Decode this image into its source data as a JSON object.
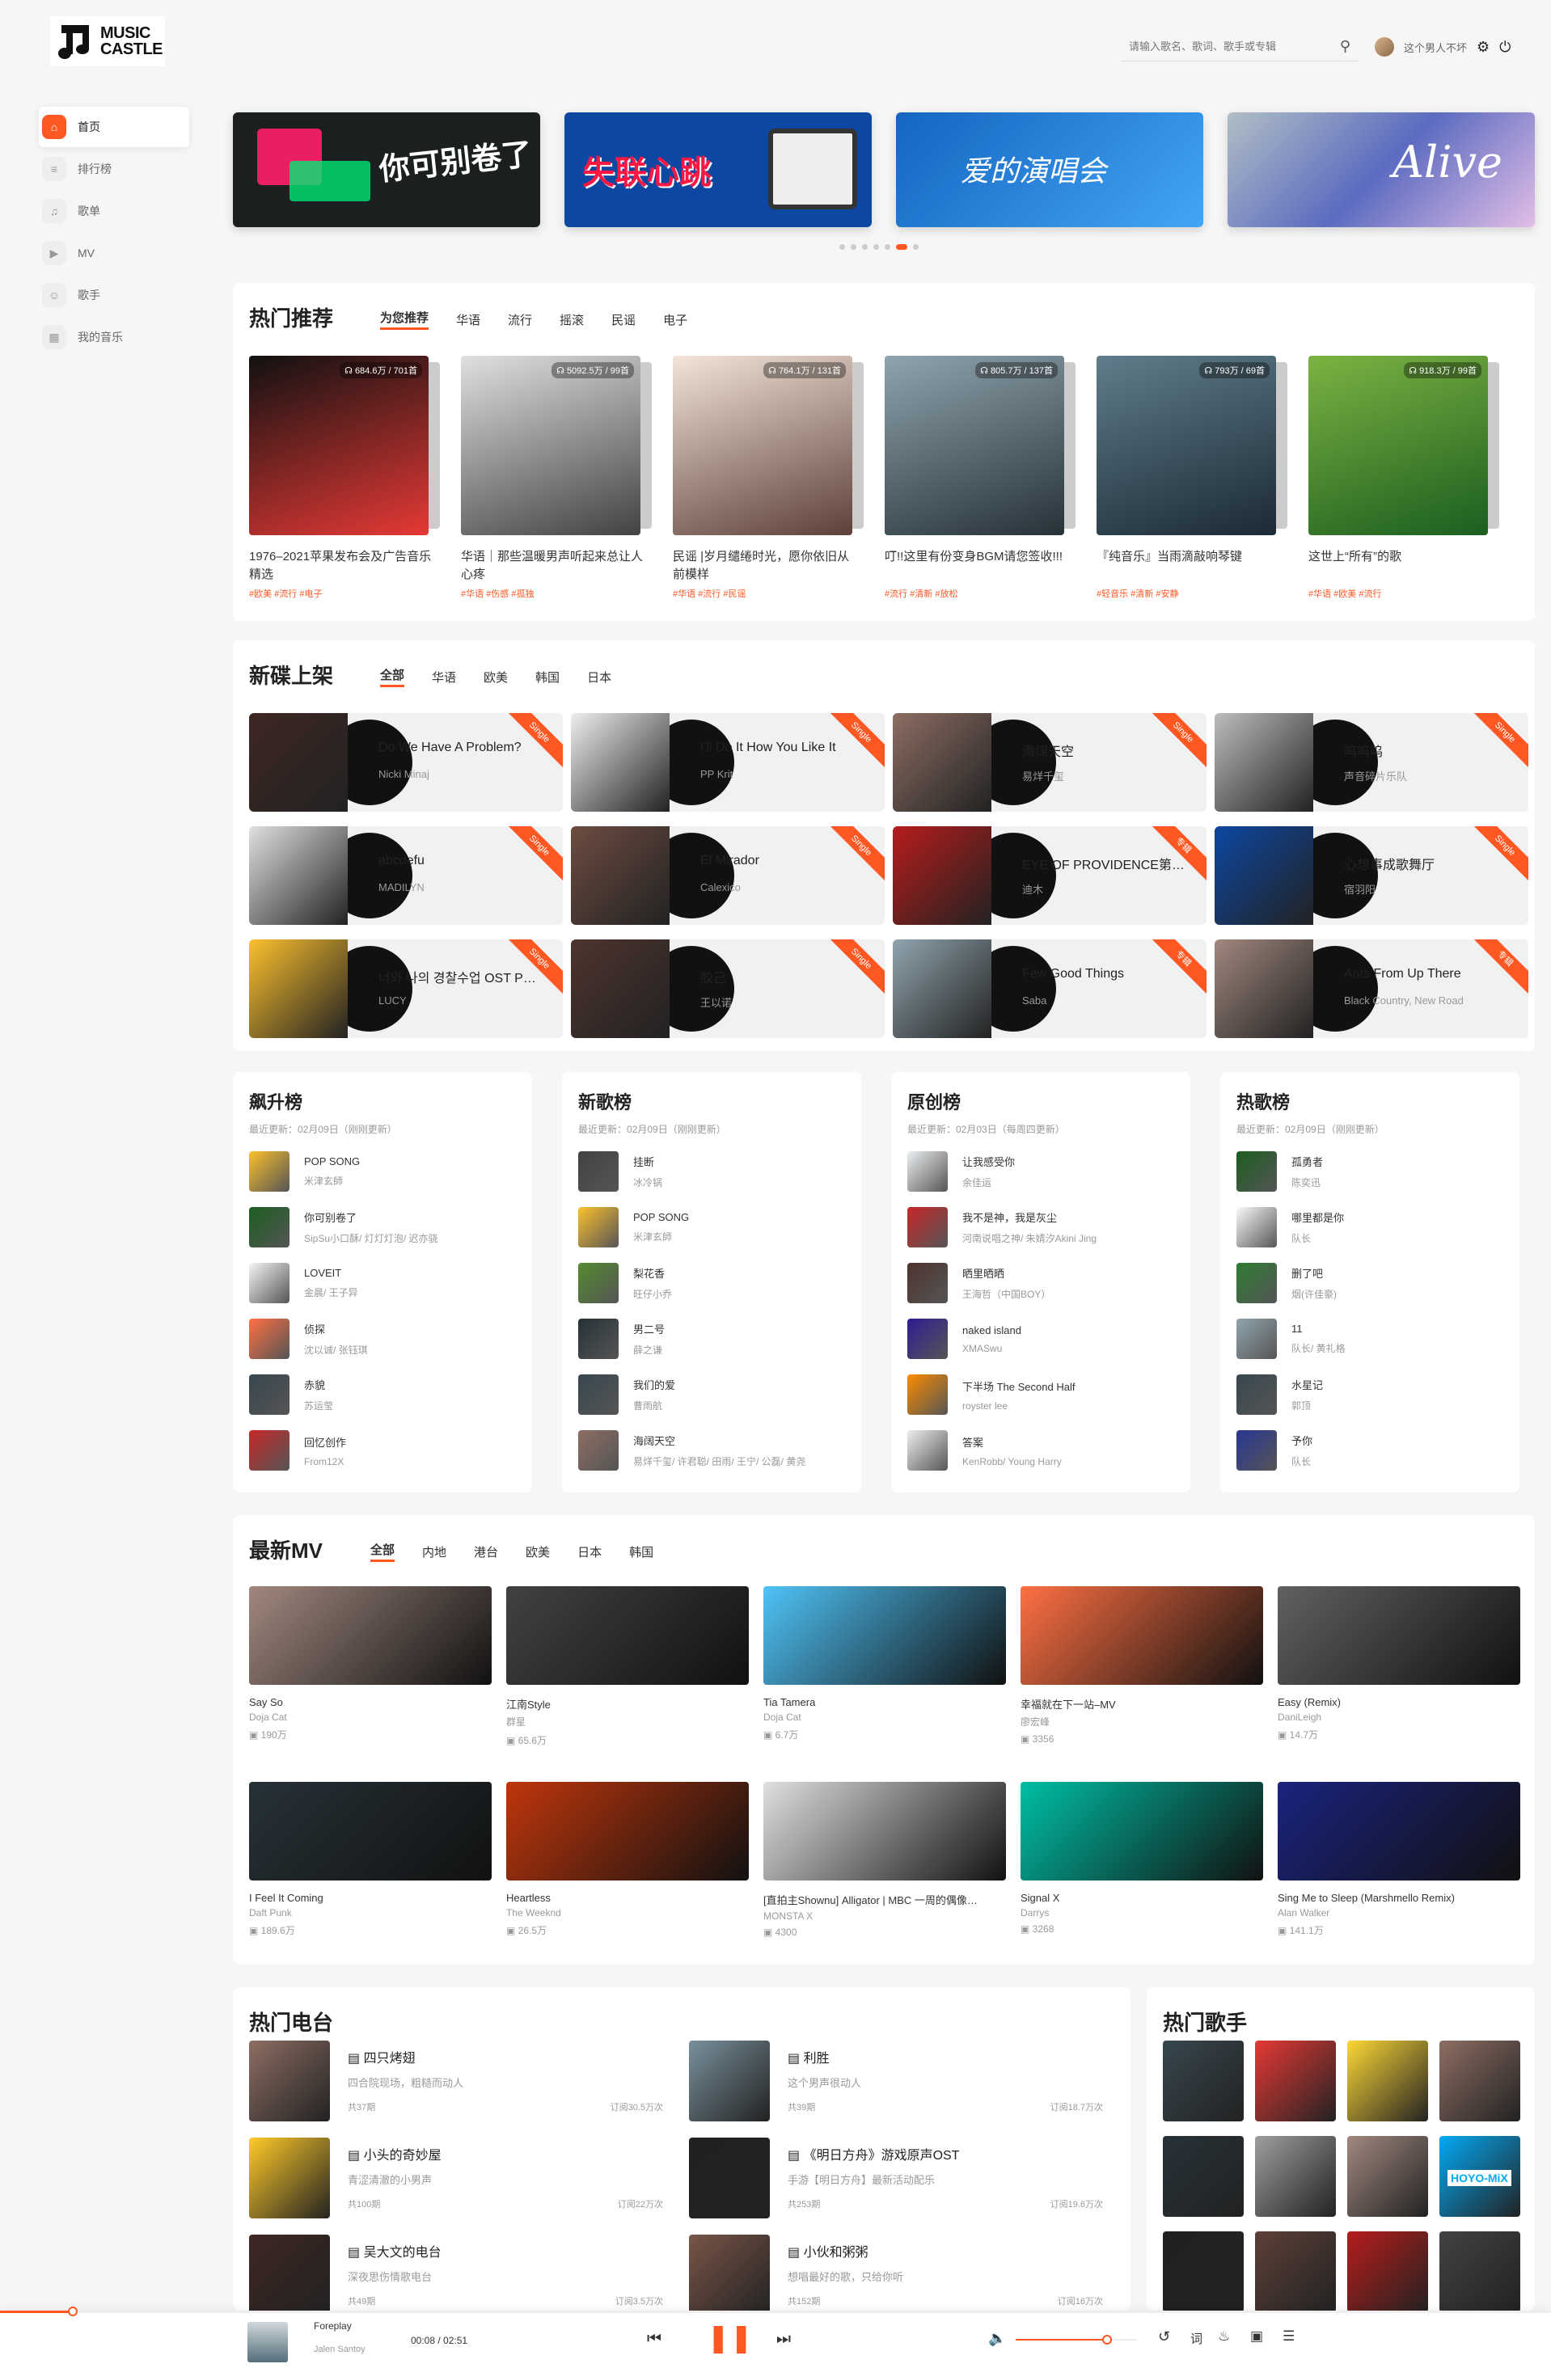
{
  "brand": {
    "line1": "MUSIC",
    "line2": "CASTLE"
  },
  "search": {
    "placeholder": "请输入歌名、歌词、歌手或专辑"
  },
  "user": {
    "name": "这个男人不坏"
  },
  "sidebar": {
    "items": [
      {
        "label": "首页",
        "icon": "home-icon"
      },
      {
        "label": "排行榜",
        "icon": "chart-icon"
      },
      {
        "label": "歌单",
        "icon": "playlist-icon"
      },
      {
        "label": "MV",
        "icon": "video-icon"
      },
      {
        "label": "歌手",
        "icon": "singer-icon"
      },
      {
        "label": "我的音乐",
        "icon": "grid-icon"
      }
    ]
  },
  "banners": [
    {
      "text": "你可别卷了",
      "bg": "#1b1f1f"
    },
    {
      "text": "失联心跳",
      "bg": "#0d47a1"
    },
    {
      "text": "爱的演唱会",
      "bg": "#1e88e5"
    },
    {
      "text": "Alive",
      "bg": "#6a8fc7"
    }
  ],
  "hot": {
    "title": "热门推荐",
    "tabs": [
      "为您推荐",
      "华语",
      "流行",
      "摇滚",
      "民谣",
      "电子"
    ],
    "items": [
      {
        "plays": "684.6万 / 701首",
        "title": "1976–2021苹果发布会及广告音乐精选",
        "tags": "#欧美 #流行 #电子",
        "c1": "#111",
        "c2": "#e53935"
      },
      {
        "plays": "5092.5万 / 99首",
        "title": "华语｜那些温暖男声听起来总让人心疼",
        "tags": "#华语 #伤感 #孤独",
        "c1": "#e0e0e0",
        "c2": "#424242"
      },
      {
        "plays": "764.1万 / 131首",
        "title": "民谣 |岁月缱绻时光，愿你依旧从前模样",
        "tags": "#华语 #流行 #民谣",
        "c1": "#f3e5d8",
        "c2": "#5d4037"
      },
      {
        "plays": "805.7万 / 137首",
        "title": "叮!!这里有份变身BGM请您签收!!!",
        "tags": "#流行 #清新 #放松",
        "c1": "#90a4ae",
        "c2": "#263238"
      },
      {
        "plays": "793万 / 69首",
        "title": "『纯音乐』当雨滴敲响琴键",
        "tags": "#轻音乐 #清新 #安静",
        "c1": "#607d8b",
        "c2": "#1b2a34"
      },
      {
        "plays": "918.3万 / 99首",
        "title": "这世上“所有”的歌",
        "tags": "#华语 #欧美 #流行",
        "c1": "#7cb342",
        "c2": "#1b5e20"
      }
    ]
  },
  "albums": {
    "title": "新碟上架",
    "tabs": [
      "全部",
      "华语",
      "欧美",
      "韩国",
      "日本"
    ],
    "items": [
      {
        "title": "Do We Have A Problem?",
        "artist": "Nicki Minaj",
        "tag": "Single",
        "c": "#3e2723"
      },
      {
        "title": "I'll Do It How You Like It",
        "artist": "PP Krit",
        "tag": "Single",
        "c": "#eeeeee"
      },
      {
        "title": "海阔天空",
        "artist": "易烊千玺",
        "tag": "Single",
        "c": "#8d6e63"
      },
      {
        "title": "呜呜呜",
        "artist": "声音碎片乐队",
        "tag": "Single",
        "c": "#bdbdbd"
      },
      {
        "title": "abcdefu",
        "artist": "MADILYN",
        "tag": "Single",
        "c": "#e0e0e0"
      },
      {
        "title": "El Mirador",
        "artist": "Calexico",
        "tag": "Single",
        "c": "#6d4c41"
      },
      {
        "title": "EYE OF PROVIDENCE第…",
        "artist": "迪木",
        "tag": "专辑",
        "c": "#b71c1c"
      },
      {
        "title": "心想事成歌舞厅",
        "artist": "宿羽阳",
        "tag": "Single",
        "c": "#0d47a1"
      },
      {
        "title": "너와 나의 경찰수업 OST P…",
        "artist": "LUCY",
        "tag": "Single",
        "c": "#fbc02d"
      },
      {
        "title": "胶己",
        "artist": "王以诺",
        "tag": "Single",
        "c": "#4e342e"
      },
      {
        "title": "Few Good Things",
        "artist": "Saba",
        "tag": "专辑",
        "c": "#90a4ae"
      },
      {
        "title": "Ants From Up There",
        "artist": "Black Country, New Road",
        "tag": "专辑",
        "c": "#a1887f"
      }
    ]
  },
  "charts": [
    {
      "title": "飙升榜",
      "update": "最近更新：02月09日（刚刚更新）",
      "songs": [
        {
          "s": "POP SONG",
          "a": "米津玄師",
          "c": "#fbc02d"
        },
        {
          "s": "你可别卷了",
          "a": "SipSu小口酥/ 灯灯灯泡/ 迟亦骁",
          "c": "#1b5e20"
        },
        {
          "s": "LOVEIT",
          "a": "金晨/ 王子异",
          "c": "#f5f5f5"
        },
        {
          "s": "侦探",
          "a": "沈以诚/ 张钰琪",
          "c": "#ff7043"
        },
        {
          "s": "赤貌",
          "a": "苏运莹",
          "c": "#37474f"
        },
        {
          "s": "回忆创作",
          "a": "From12X",
          "c": "#c62828"
        }
      ]
    },
    {
      "title": "新歌榜",
      "update": "最近更新：02月09日（刚刚更新）",
      "songs": [
        {
          "s": "挂断",
          "a": "冰冷锅",
          "c": "#424242"
        },
        {
          "s": "POP SONG",
          "a": "米津玄師",
          "c": "#fbc02d"
        },
        {
          "s": "梨花香",
          "a": "旺仔小乔",
          "c": "#558b2f"
        },
        {
          "s": "男二号",
          "a": "薛之谦",
          "c": "#263238"
        },
        {
          "s": "我们的爱",
          "a": "曹雨航",
          "c": "#37474f"
        },
        {
          "s": "海阔天空",
          "a": "易烊千玺/ 许君聪/ 田雨/ 王宁/ 公磊/ 黄尧",
          "c": "#8d6e63"
        }
      ]
    },
    {
      "title": "原创榜",
      "update": "最近更新：02月03日（每周四更新）",
      "songs": [
        {
          "s": "让我感受你",
          "a": "余佳运",
          "c": "#eceff1"
        },
        {
          "s": "我不是神，我是灰尘",
          "a": "河南说唱之神/ 朱婧汐Akini Jing",
          "c": "#c62828"
        },
        {
          "s": "晒里晒晒",
          "a": "王海哲（中国BOY）",
          "c": "#4e342e"
        },
        {
          "s": "naked island",
          "a": "XMASwu",
          "c": "#311b92"
        },
        {
          "s": "下半场 The Second Half",
          "a": "royster lee",
          "c": "#fb8c00"
        },
        {
          "s": "答案",
          "a": "KenRobb/ Young Harry",
          "c": "#eeeeee"
        }
      ]
    },
    {
      "title": "热歌榜",
      "update": "最近更新：02月09日（刚刚更新）",
      "songs": [
        {
          "s": "孤勇者",
          "a": "陈奕迅",
          "c": "#1b5e20"
        },
        {
          "s": "哪里都是你",
          "a": "队长",
          "c": "#fafafa"
        },
        {
          "s": "删了吧",
          "a": "烟(许佳豪)",
          "c": "#2e7d32"
        },
        {
          "s": "11",
          "a": "队长/ 黄礼格",
          "c": "#90a4ae"
        },
        {
          "s": "水星记",
          "a": "郭顶",
          "c": "#37474f"
        },
        {
          "s": "予你",
          "a": "队长",
          "c": "#283593"
        }
      ]
    }
  ],
  "mv": {
    "title": "最新MV",
    "tabs": [
      "全部",
      "内地",
      "港台",
      "欧美",
      "日本",
      "韩国"
    ],
    "items": [
      {
        "t": "Say So",
        "a": "Doja Cat",
        "p": "190万",
        "c": "#a1887f"
      },
      {
        "t": "江南Style",
        "a": "群星",
        "p": "65.6万",
        "c": "#424242"
      },
      {
        "t": "Tia Tamera",
        "a": "Doja Cat",
        "p": "6.7万",
        "c": "#4fc3f7"
      },
      {
        "t": "幸福就在下一站–MV",
        "a": "廖宏峰",
        "p": "3356",
        "c": "#ff7043"
      },
      {
        "t": "Easy (Remix)",
        "a": "DaniLeigh",
        "p": "14.7万",
        "c": "#616161"
      },
      {
        "t": "I Feel It Coming",
        "a": "Daft Punk",
        "p": "189.6万",
        "c": "#263238"
      },
      {
        "t": "Heartless",
        "a": "The Weeknd",
        "p": "26.5万",
        "c": "#bf360c"
      },
      {
        "t": "[直拍主Shownu] Alligator | MBC 一周的偶像…",
        "a": "MONSTA X",
        "p": "4300",
        "c": "#e0e0e0"
      },
      {
        "t": "Signal X",
        "a": "Darrys",
        "p": "3268",
        "c": "#00bfa5"
      },
      {
        "t": "Sing Me to Sleep (Marshmello Remix)",
        "a": "Alan Walker",
        "p": "141.1万",
        "c": "#1a237e"
      }
    ]
  },
  "radio": {
    "title": "热门电台",
    "items": [
      {
        "n": "四只烤翅",
        "d": "四合院现场，粗糙而动人",
        "p": "共37期",
        "s": "订阅30.5万次",
        "c": "#8d6e63"
      },
      {
        "n": "利胜",
        "d": "这个男声很动人",
        "p": "共39期",
        "s": "订阅18.7万次",
        "c": "#78909c"
      },
      {
        "n": "小头的奇妙屋",
        "d": "青涩清澈的小男声",
        "p": "共100期",
        "s": "订阅22万次",
        "c": "#ffca28"
      },
      {
        "n": "《明日方舟》游戏原声OST",
        "d": "手游【明日方舟】最新活动配乐",
        "p": "共253期",
        "s": "订阅19.6万次",
        "c": "#212121"
      },
      {
        "n": "吴大文的电台",
        "d": "深夜思伤情歌电台",
        "p": "共49期",
        "s": "订阅3.5万次",
        "c": "#3e2723"
      },
      {
        "n": "小伙和粥粥",
        "d": "想唱最好的歌，只给你听",
        "p": "共152期",
        "s": "订阅16万次",
        "c": "#795548"
      }
    ]
  },
  "singers": {
    "title": "热门歌手",
    "colors": [
      "#37474f",
      "#e53935",
      "#fdd835",
      "#8d6e63",
      "#263238",
      "#9e9e9e",
      "#a1887f",
      "#03a9f4",
      "#212121",
      "#5d4037",
      "#b71c1c",
      "#424242"
    ],
    "badge": "HOYO-MiX"
  },
  "player": {
    "song": "Foreplay",
    "artist": "Jalen Santoy",
    "time": "00:08",
    "duration": "02:51",
    "lyric_label": "词",
    "progress": 0.047,
    "volume": 0.75
  }
}
